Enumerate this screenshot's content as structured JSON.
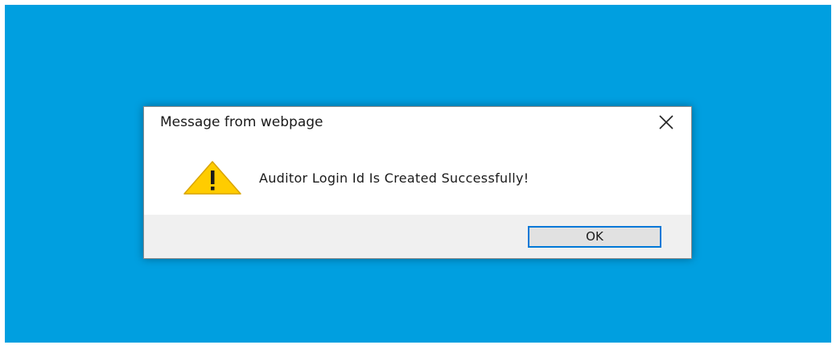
{
  "dialog": {
    "title": "Message from webpage",
    "close_icon": "close-icon",
    "message": "Auditor Login Id Is Created Successfully!",
    "icon": "warning-icon",
    "ok_label": "OK"
  },
  "colors": {
    "desktop_background": "#009fe0",
    "button_focus_border": "#0078d7",
    "warning_fill": "#ffcc00"
  }
}
